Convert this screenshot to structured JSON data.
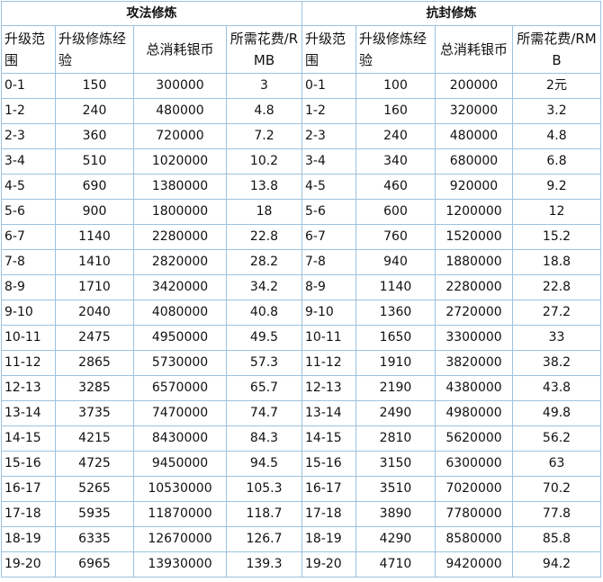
{
  "left": {
    "title": "攻法修炼",
    "headers": [
      "升级范围",
      "升级修炼经验",
      "总消耗银币",
      "所需花费/RMB"
    ],
    "rows": [
      [
        "0-1",
        "150",
        "300000",
        "3"
      ],
      [
        "1-2",
        "240",
        "480000",
        "4.8"
      ],
      [
        "2-3",
        "360",
        "720000",
        "7.2"
      ],
      [
        "3-4",
        "510",
        "1020000",
        "10.2"
      ],
      [
        "4-5",
        "690",
        "1380000",
        "13.8"
      ],
      [
        "5-6",
        "900",
        "1800000",
        "18"
      ],
      [
        "6-7",
        "1140",
        "2280000",
        "22.8"
      ],
      [
        "7-8",
        "1410",
        "2820000",
        "28.2"
      ],
      [
        "8-9",
        "1710",
        "3420000",
        "34.2"
      ],
      [
        "9-10",
        "2040",
        "4080000",
        "40.8"
      ],
      [
        "10-11",
        "2475",
        "4950000",
        "49.5"
      ],
      [
        "11-12",
        "2865",
        "5730000",
        "57.3"
      ],
      [
        "12-13",
        "3285",
        "6570000",
        "65.7"
      ],
      [
        "13-14",
        "3735",
        "7470000",
        "74.7"
      ],
      [
        "14-15",
        "4215",
        "8430000",
        "84.3"
      ],
      [
        "15-16",
        "4725",
        "9450000",
        "94.5"
      ],
      [
        "16-17",
        "5265",
        "10530000",
        "105.3"
      ],
      [
        "17-18",
        "5935",
        "11870000",
        "118.7"
      ],
      [
        "18-19",
        "6335",
        "12670000",
        "126.7"
      ],
      [
        "19-20",
        "6965",
        "13930000",
        "139.3"
      ]
    ]
  },
  "right": {
    "title": "抗封修炼",
    "headers": [
      "升级范围",
      "升级修炼经验",
      "总消耗银币",
      "所需花费/RMB"
    ],
    "rows": [
      [
        "0-1",
        "100",
        "200000",
        "2元"
      ],
      [
        "1-2",
        "160",
        "320000",
        "3.2"
      ],
      [
        "2-3",
        "240",
        "480000",
        "4.8"
      ],
      [
        "3-4",
        "340",
        "680000",
        "6.8"
      ],
      [
        "4-5",
        "460",
        "920000",
        "9.2"
      ],
      [
        "5-6",
        "600",
        "1200000",
        "12"
      ],
      [
        "6-7",
        "760",
        "1520000",
        "15.2"
      ],
      [
        "7-8",
        "940",
        "1880000",
        "18.8"
      ],
      [
        "8-9",
        "1140",
        "2280000",
        "22.8"
      ],
      [
        "9-10",
        "1360",
        "2720000",
        "27.2"
      ],
      [
        "10-11",
        "1650",
        "3300000",
        "33"
      ],
      [
        "11-12",
        "1910",
        "3820000",
        "38.2"
      ],
      [
        "12-13",
        "2190",
        "4380000",
        "43.8"
      ],
      [
        "13-14",
        "2490",
        "4980000",
        "49.8"
      ],
      [
        "14-15",
        "2810",
        "5620000",
        "56.2"
      ],
      [
        "15-16",
        "3150",
        "6300000",
        "63"
      ],
      [
        "16-17",
        "3510",
        "7020000",
        "70.2"
      ],
      [
        "17-18",
        "3890",
        "7780000",
        "77.8"
      ],
      [
        "18-19",
        "4290",
        "8580000",
        "85.8"
      ],
      [
        "19-20",
        "4710",
        "9420000",
        "94.2"
      ]
    ]
  }
}
